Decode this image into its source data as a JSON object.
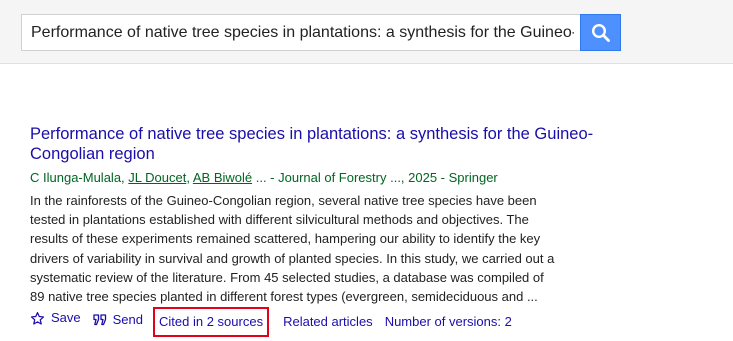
{
  "search": {
    "query": "Performance of native tree species in plantations: a synthesis for the Guineo-"
  },
  "result": {
    "title": "Performance of native tree species in plantations: a synthesis for the Guineo-Congolian region",
    "author_1": "C Ilunga-Mulala",
    "author_2": "JL Doucet",
    "author_3": "AB Biwolé",
    "meta_rest": " ... - Journal of Forestry ..., 2025 - Springer",
    "snippet": "In the rainforests of the Guineo-Congolian region, several native tree species have been tested in plantations established with different silvicultural methods and objectives. The results of these experiments remained scattered, hampering our ability to identify the key drivers of variability in survival and growth of planted species. In this study, we carried out a systematic review of the literature. From 45 selected studies, a database was compiled of 89 native tree species planted in different forest types (evergreen, semideciduous and ..."
  },
  "actions": {
    "save": "Save",
    "send": "Send",
    "cited": "Cited in 2 sources",
    "related": "Related articles",
    "versions": "Number of versions: 2"
  },
  "colors": {
    "link": "#1a0dab",
    "meta": "#006621",
    "search_button": "#4d90fe",
    "highlight_box": "#e2001a"
  },
  "icons": {
    "search_button_icon": "search-icon",
    "save_icon": "star-outline-icon",
    "send_icon": "quote-icon"
  }
}
